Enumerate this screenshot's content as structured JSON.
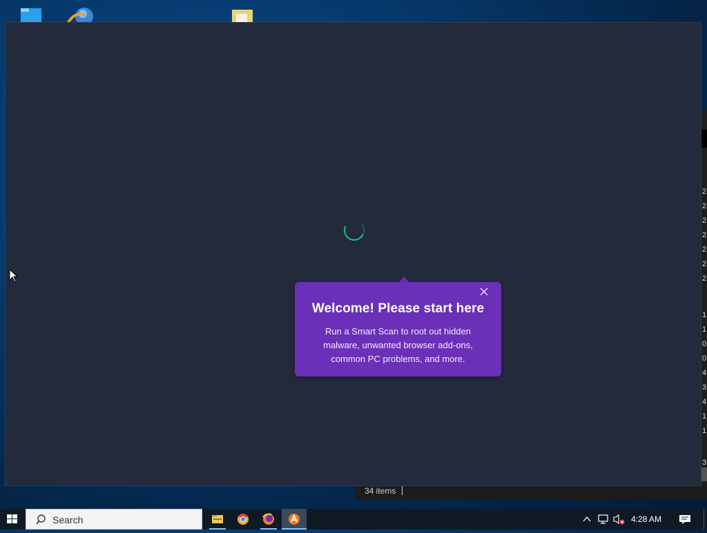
{
  "desktop": {
    "icons": [
      "folder-icon",
      "globe-browser-icon",
      "document-folder-icon"
    ]
  },
  "background_window": {
    "status_items": "34 items",
    "numbers": [
      "2",
      "2",
      "2",
      "2",
      "2",
      "2",
      "2",
      "1",
      "1",
      "0",
      "0",
      "4",
      "3",
      "4",
      "1",
      "1",
      "3"
    ]
  },
  "app": {
    "popup": {
      "title": "Welcome! Please start here",
      "body": "Run a Smart Scan to root out hidden malware, unwanted browser add-ons, common PC problems, and more.",
      "close_icon": "close-icon"
    },
    "colors": {
      "window_bg": "#222a3c",
      "popup_bg": "#6a30b8",
      "spinner": "#1fc47a"
    }
  },
  "taskbar": {
    "search_placeholder": "Search",
    "apps": [
      "file-explorer-icon",
      "chrome-browser-icon",
      "firefox-icon",
      "avast-icon"
    ],
    "active_app": "avast-icon",
    "clock": "4:28 AM"
  }
}
